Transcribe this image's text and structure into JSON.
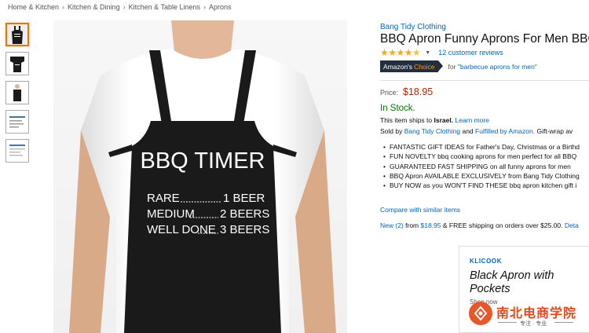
{
  "breadcrumb": [
    "Home & Kitchen",
    "Kitchen & Dining",
    "Kitchen & Table Linens",
    "Aprons"
  ],
  "breadcrumb_separator": "›",
  "thumbnails": [
    {
      "name": "thumb-apron-front",
      "selected": true
    },
    {
      "name": "thumb-apron-flat",
      "selected": false
    },
    {
      "name": "thumb-apron-model",
      "selected": false
    },
    {
      "name": "thumb-apron-text",
      "selected": false
    },
    {
      "name": "thumb-apron-detail",
      "selected": false
    }
  ],
  "apron_print": {
    "heading": "BBQ TIMER",
    "rows": [
      {
        "label": "RARE",
        "value": "1 BEER"
      },
      {
        "label": "MEDIUM",
        "value": "2 BEERS"
      },
      {
        "label": "WELL DONE",
        "value": "3 BEERS"
      }
    ]
  },
  "product": {
    "brand": "Bang Tidy Clothing",
    "title": "BBQ Apron Funny Aprons For Men BBQ T",
    "stars": "★★★★",
    "stars_half": "★",
    "rating_caret": "▼",
    "reviews": "12 customer reviews",
    "choice_label_1": "Amazon's",
    "choice_label_2": "Choice",
    "choice_for": "for",
    "choice_query": "\"barbecue aprons for men\"",
    "price_label": "Price:",
    "price": "$18.95",
    "stock": "In Stock.",
    "ships_prefix": "This item ships to",
    "ships_country": "Israel.",
    "learn_more": "Learn more",
    "sold_prefix": "Sold by",
    "seller": "Bang Tidy Clothing",
    "sold_and": "and",
    "fulfilled": "Fulfilled by Amazon.",
    "gift": "Gift-wrap av",
    "bullets": [
      "FANTASTIC GIFT IDEAS for Father's Day, Christmas or a Birthd",
      "FUN NOVELTY bbq cooking aprons for men perfect for all BBQ",
      "GUARANTEED FAST SHIPPING on all funny aprons for men",
      "BBQ Apron AVAILABLE EXCLUSIVELY from Bang Tidy Clothing",
      "BUY NOW as you WON'T FIND THESE bbq apron kitchen gift i"
    ],
    "compare": "Compare with similar items",
    "offers_new": "New (2)",
    "offers_from": "from",
    "offers_price": "$18.95",
    "offers_rest": "& FREE shipping on orders over $25.00.",
    "offers_details": "Deta"
  },
  "ad": {
    "brand": "KLICOOK",
    "title": "Black Apron with Pockets",
    "shop": "Shop now"
  },
  "watermark": {
    "text": "南北电商学院",
    "sub": "专注 · 专业"
  },
  "colors": {
    "link": "#0066c0",
    "price": "#b12704",
    "stock": "#007600",
    "star": "#ffa41c",
    "badge_bg": "#232f3e",
    "badge_accent": "#ff9900",
    "apron": "#1a1a1a"
  }
}
